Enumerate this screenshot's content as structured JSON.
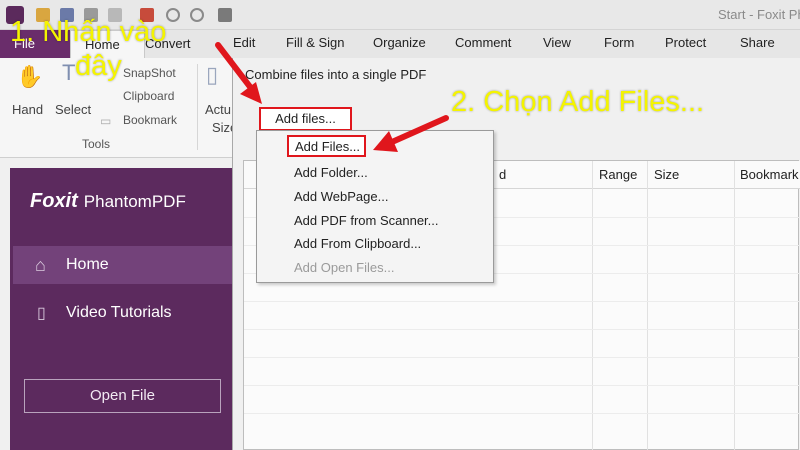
{
  "window": {
    "title": "Start - Foxit Ph"
  },
  "ribbon_tabs": {
    "file": "File",
    "home": "Home",
    "convert": "Convert",
    "edit": "Edit",
    "fill_sign": "Fill & Sign",
    "organize": "Organize",
    "comment": "Comment",
    "view": "View",
    "form": "Form",
    "protect": "Protect",
    "share": "Share"
  },
  "ribbon_tools": {
    "hand": "Hand",
    "select": "Select",
    "snapshot": "SnapShot",
    "clipboard": "Clipboard",
    "bookmark": "Bookmark",
    "actual_size_line1": "Actu",
    "actual_size_line2": "Size",
    "group_label": "Tools"
  },
  "sidebar": {
    "brand_name": "Foxit",
    "product_name": "PhantomPDF",
    "items": [
      {
        "label": "Home",
        "icon": "home-icon"
      },
      {
        "label": "Video Tutorials",
        "icon": "book-icon"
      }
    ],
    "open_file_label": "Open File"
  },
  "dialog": {
    "title": "Combine files into a single PDF",
    "add_files_label": "Add files...",
    "table_headers": {
      "name": "d",
      "range": "Range",
      "size": "Size",
      "bookmark": "Bookmark"
    }
  },
  "dropdown_menu": {
    "items": [
      {
        "label": "Add Files...",
        "enabled": true,
        "highlighted": true
      },
      {
        "label": "Add Folder...",
        "enabled": true
      },
      {
        "label": "Add WebPage...",
        "enabled": true
      },
      {
        "label": "Add PDF from Scanner...",
        "enabled": true
      },
      {
        "label": "Add From Clipboard...",
        "enabled": true
      },
      {
        "label": "Add Open Files...",
        "enabled": false
      }
    ]
  },
  "annotations": {
    "step1_line1": "1. Nhấn vào",
    "step1_line2": "đây",
    "step2": "2. Chọn Add Files..."
  },
  "colors": {
    "brand_purple": "#5c2a5e",
    "highlight_red": "#e0161c",
    "annotation_yellow": "#f4f400"
  }
}
